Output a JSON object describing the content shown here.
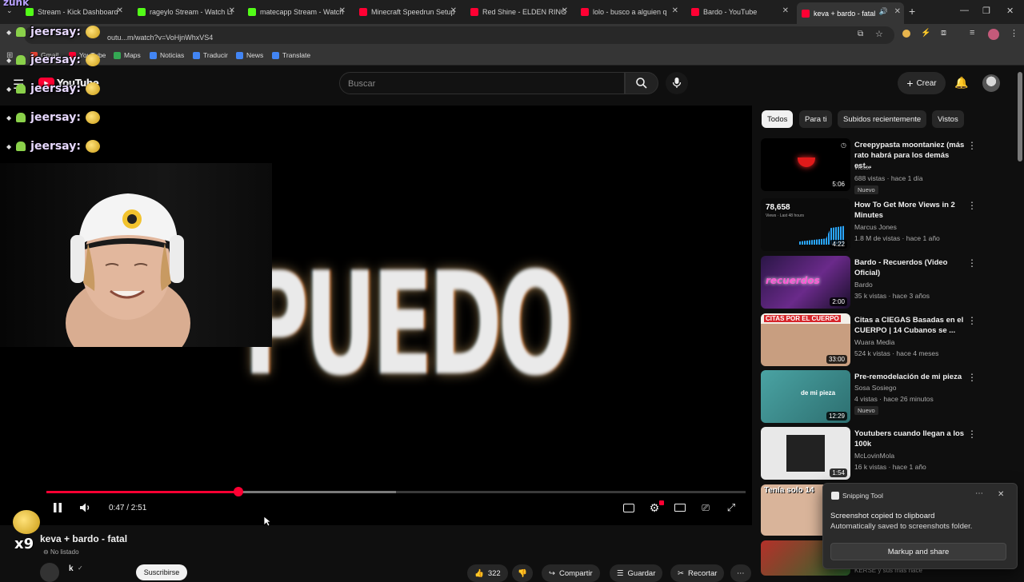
{
  "browser": {
    "tabs": [
      {
        "label": "Stream - Kick Dashboard",
        "color": "#53fc18"
      },
      {
        "label": "rageylo Stream - Watch Li",
        "color": "#53fc18"
      },
      {
        "label": "matecapp Stream - Watch",
        "color": "#53fc18"
      },
      {
        "label": "Minecraft Speedrun Setup",
        "color": "#ff0033"
      },
      {
        "label": "Red Shine - ELDEN RING",
        "color": "#ff0033"
      },
      {
        "label": "lolo - busco a alguien q",
        "color": "#ff0033"
      },
      {
        "label": "Bardo - YouTube",
        "color": "#ff0033"
      },
      {
        "label": "keva + bardo - fatal",
        "color": "#ff0033"
      }
    ],
    "url": "outu...m/watch?v=VoHjnWhxVS4",
    "bookmarks": [
      "Gmail",
      "YouTube",
      "Maps",
      "Noticias",
      "Traducir",
      "News",
      "Translate"
    ]
  },
  "overlay": {
    "corner_text": "zunk",
    "chat_user": "jeersay:",
    "combo": "x9"
  },
  "youtube": {
    "logo": "YouTube",
    "search_placeholder": "Buscar",
    "create_label": "Crear",
    "player": {
      "caption_text": "PUEDO",
      "time": "0:47 / 2:51",
      "progress": 0.275,
      "buffered": 0.5
    },
    "video": {
      "title": "keva + bardo - fatal",
      "status": "No listado",
      "channel_initial": "k",
      "subscribe": "Suscribirse",
      "likes": "322",
      "share": "Compartir",
      "save": "Guardar",
      "clip": "Recortar"
    },
    "chips": [
      "Todos",
      "Para ti",
      "Subidos recientemente",
      "Vistos"
    ],
    "recommendations": [
      {
        "title": "Creepypasta moontaniez (más rato habrá para los demás est...",
        "channel": "víctor",
        "meta": "688 vistas · hace 1 día",
        "badge": "Nuevo",
        "duration": "5:06"
      },
      {
        "title": "How To Get More Views in 2 Minutes",
        "channel": "Marcus Jones",
        "meta": "1.8 M de vistas · hace 1 año",
        "badge": "",
        "duration": "4:22",
        "thumb_number": "78,658",
        "thumb_caption": "Views · Last 48 hours"
      },
      {
        "title": "Bardo - Recuerdos (Video Oficial)",
        "channel": "Bardo",
        "meta": "35 k vistas · hace 3 años",
        "badge": "",
        "duration": "2:00",
        "thumb_caption": "recuerdos"
      },
      {
        "title": "Citas a CIEGAS Basadas en el CUERPO | 14 Cubanos se ...",
        "channel": "Wuara Media",
        "meta": "524 k vistas · hace 4 meses",
        "badge": "",
        "duration": "33:00",
        "thumb_caption": "CITAS POR EL CUERPO"
      },
      {
        "title": "Pre-remodelación de mi pieza",
        "channel": "Sosa Sosiego",
        "meta": "4 vistas · hace 26 minutos",
        "badge": "Nuevo",
        "duration": "12:29",
        "thumb_caption": "de mi pieza"
      },
      {
        "title": "Youtubers cuando llegan a los 100k",
        "channel": "McLovinMola",
        "meta": "16 k vistas · hace 1 año",
        "badge": "",
        "duration": "1:54"
      }
    ],
    "partial_thumb_caption": "Tenía solo 14",
    "partial_channel": "KERSE y sus más hace"
  },
  "toast": {
    "app": "Snipping Tool",
    "title": "Screenshot copied to clipboard",
    "body": "Automatically saved to screenshots folder.",
    "button": "Markup and share"
  }
}
